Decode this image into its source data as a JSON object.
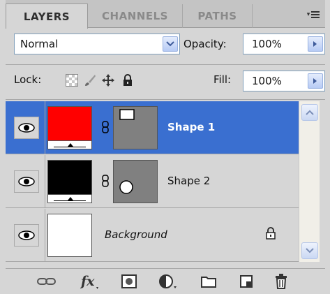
{
  "tabs": [
    {
      "label": "LAYERS",
      "active": true
    },
    {
      "label": "CHANNELS",
      "active": false
    },
    {
      "label": "PATHS",
      "active": false
    }
  ],
  "panel_menu_icon": "panel-menu-icon",
  "blend": {
    "mode": "Normal",
    "opacity_label": "Opacity:",
    "opacity_value": "100%"
  },
  "lock": {
    "label": "Lock:",
    "fill_label": "Fill:",
    "fill_value": "100%"
  },
  "layers": [
    {
      "name": "Shape 1",
      "color": "#ff0000",
      "selected": true
    },
    {
      "name": "Shape 2",
      "color": "#000000",
      "selected": false
    },
    {
      "name": "Background",
      "color": "#ffffff",
      "selected": false,
      "locked": true
    }
  ],
  "colors": {
    "selection": "#3a6fd0",
    "panel": "#d6d6d6"
  },
  "footer_icons": [
    "link-layers-icon",
    "fx-icon",
    "add-mask-icon",
    "adjustment-layer-icon",
    "new-group-icon",
    "new-layer-icon",
    "trash-icon"
  ]
}
